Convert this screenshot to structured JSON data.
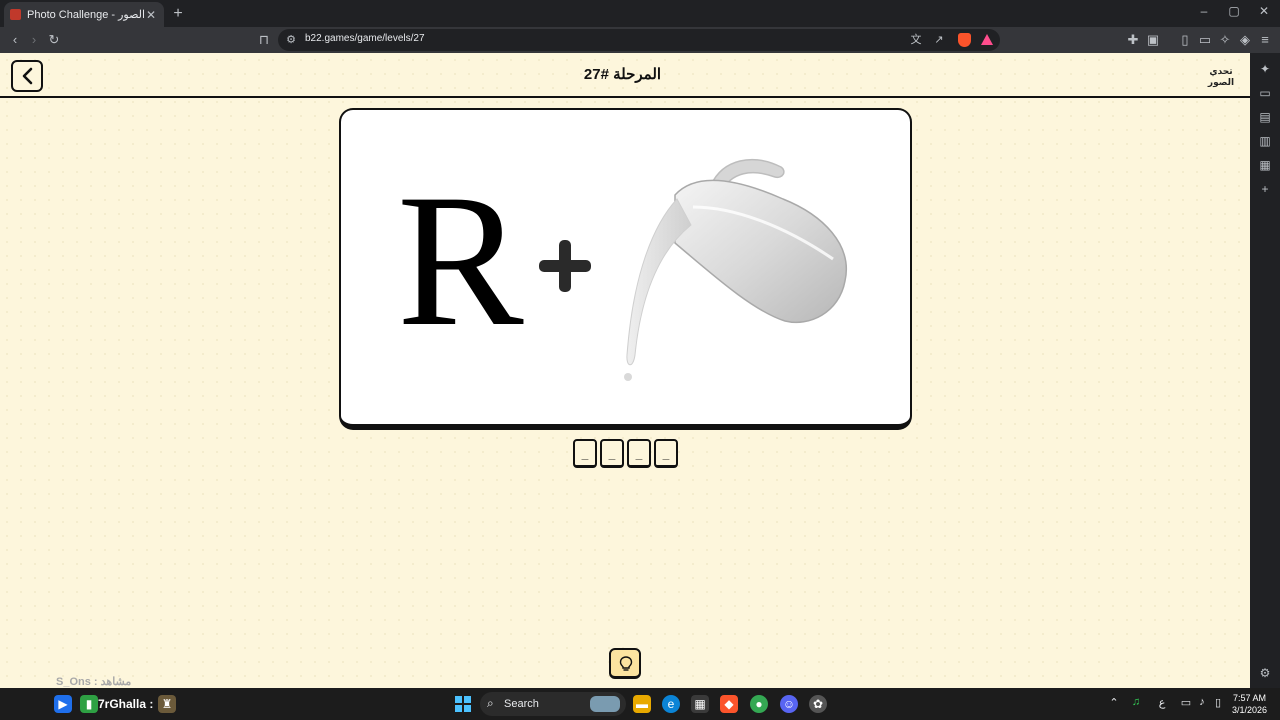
{
  "browser": {
    "tab_title": "Photo Challenge - لعبة تحدي الصور",
    "tab_close": "✕",
    "new_tab": "+",
    "url": "b22.games/game/levels/27",
    "window_controls": {
      "minimize": "–",
      "maximize": "▢",
      "close": "✕"
    }
  },
  "page": {
    "level_title": "المرحلة #27",
    "logo_text": "تحدي الصور",
    "puzzle": {
      "letter": "R",
      "plus": "+",
      "image": "milk-pitcher-pouring"
    },
    "answer_slots": [
      "_",
      "_",
      "_",
      "_"
    ],
    "hint_icon": "lightbulb-icon",
    "watermark": "S_Ons : مشاهد"
  },
  "taskbar": {
    "widget_title": "7rGhalla :",
    "search_label": "Search",
    "language": "ع",
    "time": "7:57 AM",
    "date": "3/1/2026"
  },
  "colors": {
    "page_background": "#fdf6dc",
    "card_background": "#ffffff",
    "hint_button": "#fbe3a0",
    "border": "#111111"
  }
}
